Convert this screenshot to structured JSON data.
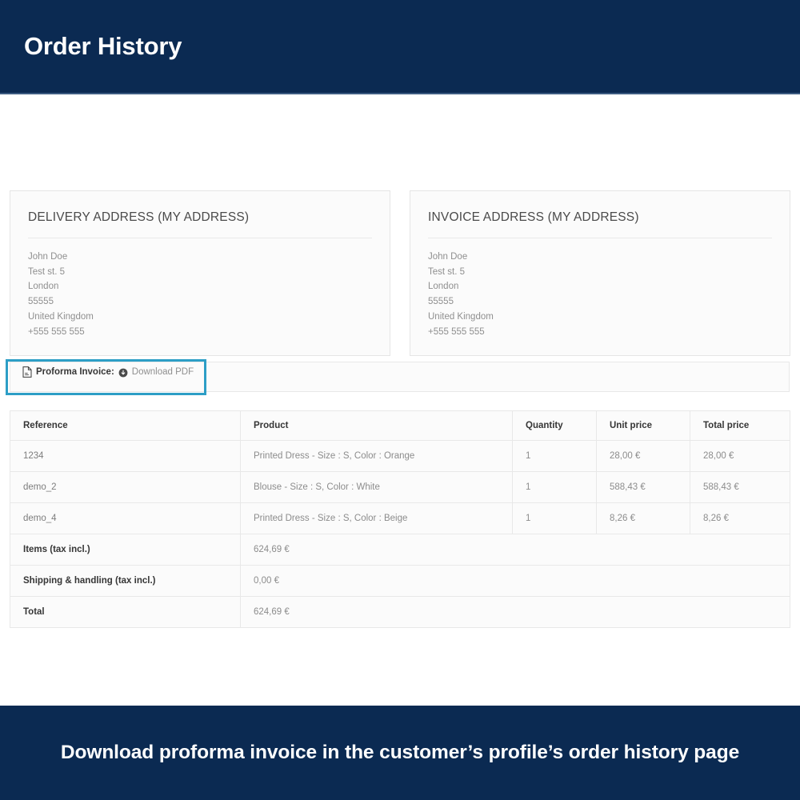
{
  "header": {
    "title": "Order History"
  },
  "addresses": [
    {
      "card_name": "delivery-address-card",
      "title": "DELIVERY ADDRESS (MY ADDRESS)",
      "lines": [
        "John Doe",
        "Test st. 5",
        "London",
        "55555",
        "United Kingdom",
        "+555 555 555"
      ]
    },
    {
      "card_name": "invoice-address-card",
      "title": "INVOICE ADDRESS (MY ADDRESS)",
      "lines": [
        "John Doe",
        "Test st. 5",
        "London",
        "55555",
        "United Kingdom",
        "+555 555 555"
      ]
    }
  ],
  "proforma": {
    "file_icon": "file-pdf-icon",
    "label": "Proforma Invoice:",
    "download_icon": "download-circle-icon",
    "link_text": "Download PDF",
    "highlight_color": "#2d9ec6"
  },
  "order_table": {
    "columns": [
      "Reference",
      "Product",
      "Quantity",
      "Unit price",
      "Total price"
    ],
    "rows": [
      {
        "reference": "1234",
        "product": "Printed Dress - Size : S, Color : Orange",
        "quantity": "1",
        "unit_price": "28,00 €",
        "total_price": "28,00 €"
      },
      {
        "reference": "demo_2",
        "product": "Blouse - Size : S, Color : White",
        "quantity": "1",
        "unit_price": "588,43 €",
        "total_price": "588,43 €"
      },
      {
        "reference": "demo_4",
        "product": "Printed Dress - Size : S, Color : Beige",
        "quantity": "1",
        "unit_price": "8,26 €",
        "total_price": "8,26 €"
      }
    ],
    "summary": [
      {
        "label": "Items (tax incl.)",
        "value": "624,69 €"
      },
      {
        "label": "Shipping & handling (tax incl.)",
        "value": "0,00 €"
      },
      {
        "label": "Total",
        "value": "624,69 €"
      }
    ]
  },
  "footer": {
    "caption": "Download proforma invoice in the customer’s profile’s order history page"
  },
  "colors": {
    "banner_navy": "#0b2a52",
    "highlight_cyan": "#2d9ec6",
    "card_bg": "#fbfbfb",
    "border": "#e8e8e8"
  }
}
